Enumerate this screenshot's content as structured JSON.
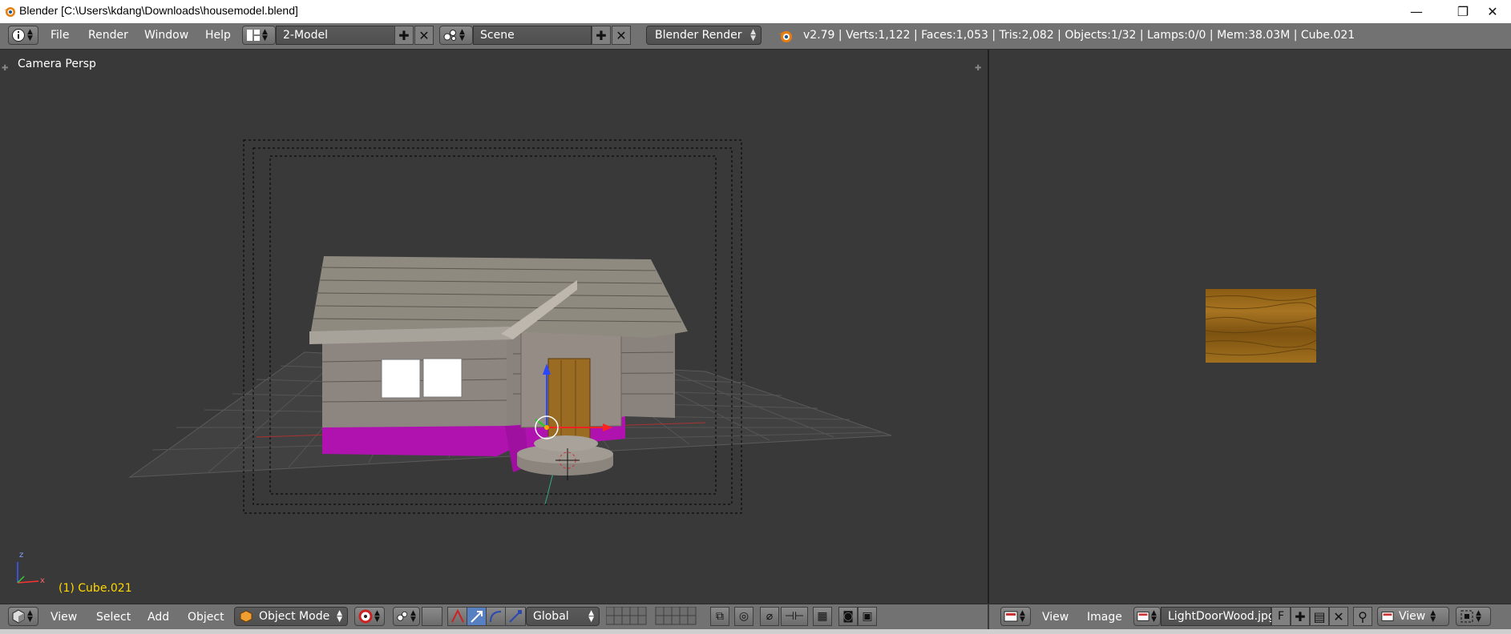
{
  "window": {
    "title": "Blender [C:\\Users\\kdang\\Downloads\\housemodel.blend]",
    "minimize": "—",
    "restore": "❐",
    "close": "✕"
  },
  "topbar": {
    "menus": [
      "File",
      "Render",
      "Window",
      "Help"
    ],
    "layout": "2-Model",
    "scene": "Scene",
    "render_engine": "Blender Render",
    "stats": "v2.79 | Verts:1,122 | Faces:1,053 | Tris:2,082 | Objects:1/32 | Lamps:0/0 | Mem:38.03M | Cube.021"
  },
  "viewport": {
    "view_name": "Camera Persp",
    "active_object": "(1) Cube.021",
    "axis_x": "x",
    "axis_z": "z"
  },
  "bottombar": {
    "menus": [
      "View",
      "Select",
      "Add",
      "Object"
    ],
    "mode": "Object Mode",
    "orientation": "Global"
  },
  "image_editor": {
    "menus": [
      "View",
      "Image"
    ],
    "image_name": "LightDoorWood.jpg",
    "fake_user": "F",
    "view_menu": "View"
  },
  "colors": {
    "header": "#727272",
    "viewport_bg": "#393939",
    "active_object_label": "#ffd800",
    "blender_orange": "#e87d0d"
  },
  "icons": [
    "info-icon",
    "screen-layout-icon",
    "scene-icon",
    "blender-logo-icon",
    "cube-view-icon",
    "object-cube-icon",
    "pivot-icon",
    "manipulator-icons",
    "layer-grid-icons",
    "lock-icon",
    "snap-icons",
    "render-icons",
    "image-editor-icon",
    "image-browse-icon",
    "pin-icon"
  ]
}
